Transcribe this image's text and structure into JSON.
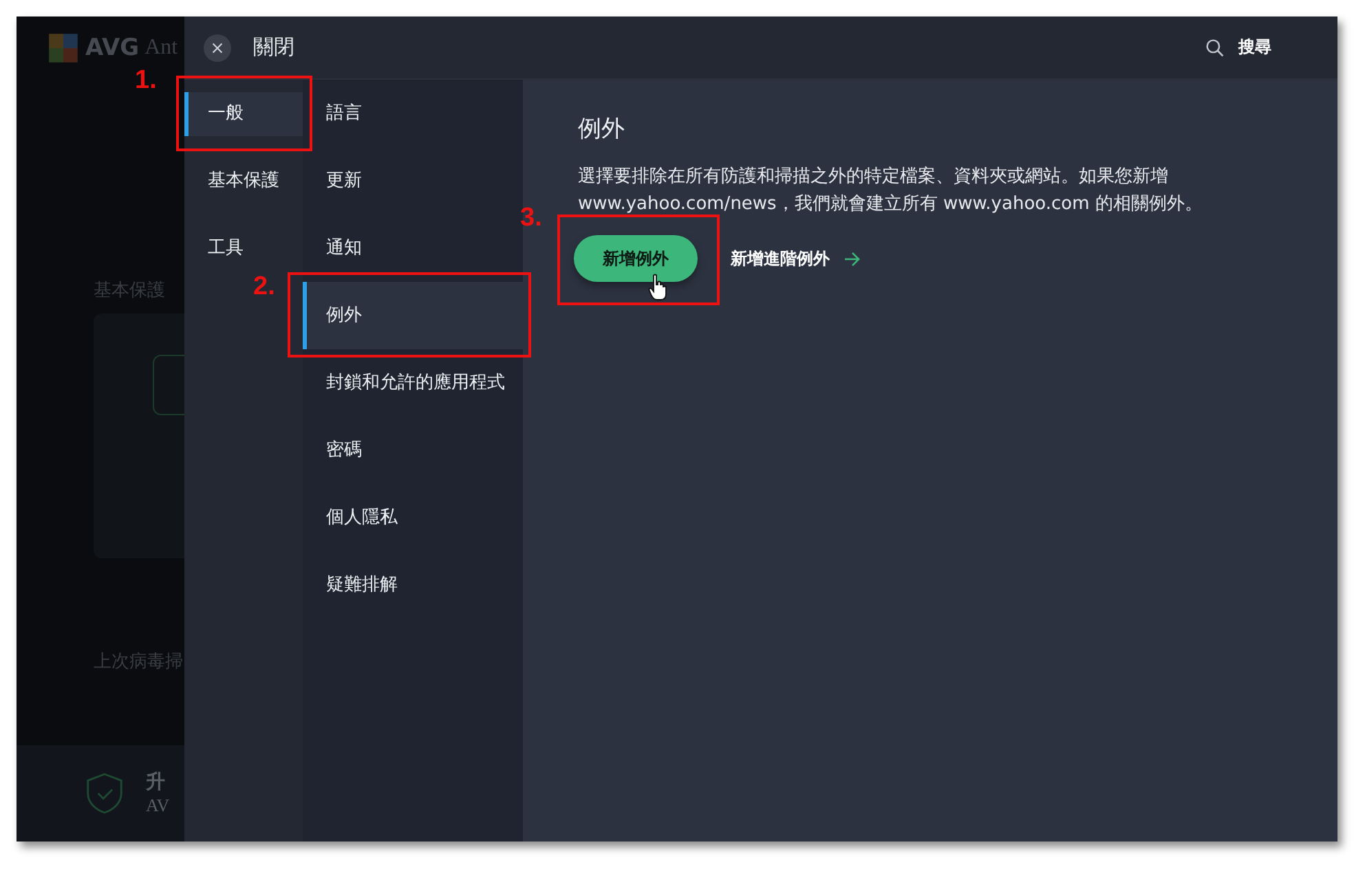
{
  "background_app": {
    "logo_text": "AVG",
    "title": "Ant",
    "section_title": "基本保護",
    "status_text": "上次病毒掃",
    "footer_title": "升",
    "footer_subtitle": "AV"
  },
  "header": {
    "close_label": "關閉",
    "search_label": "搜尋"
  },
  "categories": [
    {
      "label": "一般",
      "selected": true
    },
    {
      "label": "基本保護",
      "selected": false
    },
    {
      "label": "工具",
      "selected": false
    }
  ],
  "subcategories": [
    {
      "label": "語言",
      "selected": false
    },
    {
      "label": "更新",
      "selected": false
    },
    {
      "label": "通知",
      "selected": false
    },
    {
      "label": "例外",
      "selected": true
    },
    {
      "label": "封鎖和允許的應用程式",
      "selected": false
    },
    {
      "label": "密碼",
      "selected": false
    },
    {
      "label": "個人隱私",
      "selected": false
    },
    {
      "label": "疑難排解",
      "selected": false
    }
  ],
  "content": {
    "title": "例外",
    "description": "選擇要排除在所有防護和掃描之外的特定檔案、資料夾或網站。如果您新增 www.yahoo.com/news，我們就會建立所有 www.yahoo.com 的相關例外。",
    "primary_button": "新增例外",
    "secondary_link": "新增進階例外"
  },
  "annotations": [
    {
      "number": "1."
    },
    {
      "number": "2."
    },
    {
      "number": "3."
    }
  ]
}
